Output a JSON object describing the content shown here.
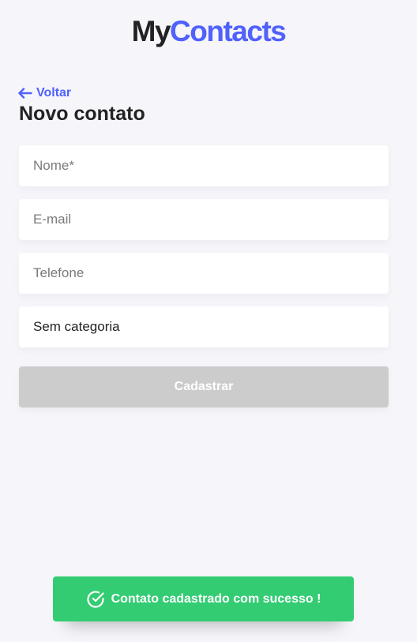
{
  "header": {
    "logo_part1": "My",
    "logo_part2": "Contacts",
    "brand_color": "#5061fc"
  },
  "nav": {
    "back_label": "Voltar",
    "back_icon": "arrow-left-icon"
  },
  "page": {
    "title": "Novo contato"
  },
  "form": {
    "name": {
      "placeholder": "Nome*",
      "value": ""
    },
    "email": {
      "placeholder": "E-mail",
      "value": ""
    },
    "phone": {
      "placeholder": "Telefone",
      "value": ""
    },
    "category": {
      "selected": "Sem categoria"
    },
    "submit_label": "Cadastrar",
    "submit_disabled_color": "#cccccc"
  },
  "toast": {
    "message": "Contato cadastrado com sucesso !",
    "icon": "check-circle-icon",
    "color": "#33cc73"
  }
}
